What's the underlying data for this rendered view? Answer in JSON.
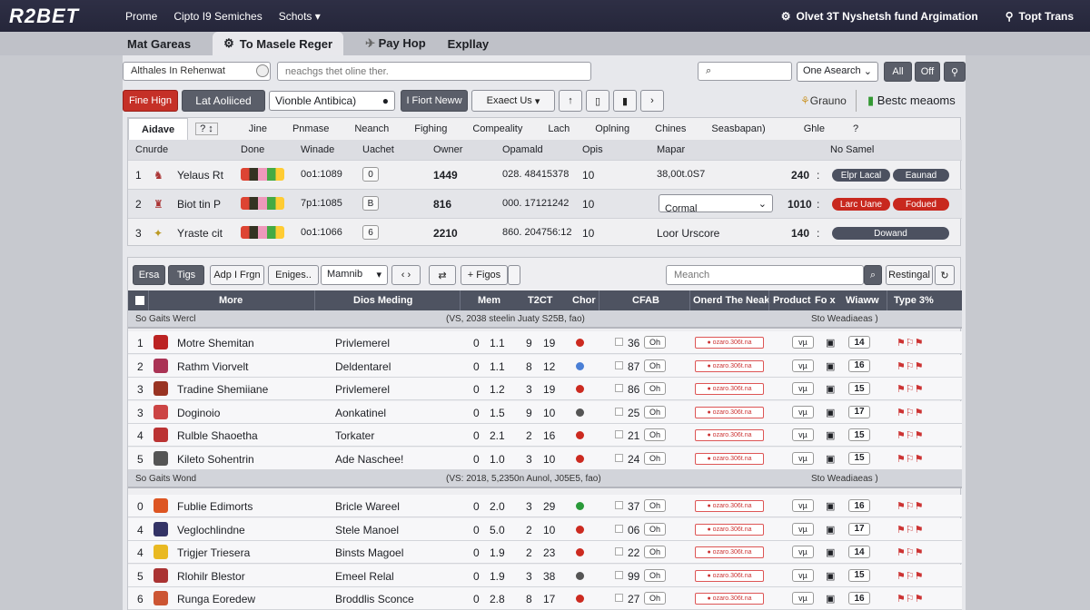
{
  "app": {
    "logo": "R2BET"
  },
  "topnav": [
    "Prome",
    "Cipto I9 Semiches",
    "Schots ▾"
  ],
  "topright": {
    "item1": "Olvet 3T Nyshetsh fund Argimation",
    "item2": "Topt Trans"
  },
  "subbar": {
    "item1": "Mat Gareas",
    "active": "To Masele Reger",
    "item3": "Pay Hop",
    "item4": "Expllay"
  },
  "filters": {
    "field1": "Althales In Rehenwat",
    "search": "",
    "search_placeholder": "neachgs thet oline ther.",
    "field3": "",
    "field3_placeholder": "",
    "select": "One Asearch",
    "btn_all": "All",
    "btn_off": "Off"
  },
  "actions": {
    "b1": "Fine Hign",
    "b2": "Lat Aoliiced",
    "b3": "Vionble Antibica)",
    "b4": "I Fiort Neww",
    "b5": "Exaect Us",
    "right1": "Grauno",
    "right2": "Bestc meaoms"
  },
  "tabs": [
    "Aidave",
    "Jine",
    "Pnmase",
    "Neanch",
    "Fighing",
    "Compeality",
    "Lach",
    "Oplning",
    "Chines",
    "Seasbapan)",
    "Ghle"
  ],
  "top_headers": {
    "h1": "Cnurde",
    "h2": "Done",
    "h3": "Winade",
    "h4": "Uachet",
    "h5": "Owner",
    "h6": "Opamald",
    "h7": "Opis",
    "h8": "Mapar",
    "h9": "No Samel"
  },
  "top_rows": [
    {
      "n": "1",
      "name": "Yelaus Rt",
      "odds": "0o1:1089",
      "owner": "1449",
      "op": "028. 48415378",
      "opis": "10",
      "mapar": "38,00t.0S7",
      "val": "240",
      "p1": "Elpr Lacal",
      "p2": "Eaunad",
      "badge": "0"
    },
    {
      "n": "2",
      "name": "Biot tin P",
      "odds": "7p1:1085",
      "owner": "816",
      "op": "000. 17121242",
      "opis": "10",
      "mapar": "Cormal",
      "val": "1010",
      "p1": "Larc Uane",
      "p2": "Fodued",
      "badge": "B"
    },
    {
      "n": "3",
      "name": "Yraste cit",
      "odds": "0o1:1066",
      "owner": "2210",
      "op": "860. 204756:12",
      "opis": "10",
      "mapar": "Loor Urscore",
      "val": "140",
      "p1": "",
      "p2": "Dowand",
      "badge": "6"
    }
  ],
  "tool2": {
    "b1": "Ersa",
    "b2": "Tigs",
    "b3": "Adp I Frgn",
    "b4": "Eniges..",
    "b5": "Mamnib",
    "b6": "+ Figos",
    "search_placeholder": "Meanch",
    "b7": "Restingal"
  },
  "main_headers": {
    "h1": "More",
    "h2": "Dios Meding",
    "h3": "Mem",
    "h4": "T2CT",
    "h5": "Chor",
    "h6": "CFAB",
    "h7": "Onerd The Neak",
    "h8": "Product",
    "h9": "Fo x",
    "h10": "Wiaww",
    "h11": "Type 3%"
  },
  "groups": [
    {
      "label": "So Gaits Wercl",
      "mid": "(VS, 2038 steelin Juaty S25B, fao)",
      "right": "Sto Weadiaeas )"
    },
    {
      "label": "So Gaits Wond",
      "mid": "(VS: 2018, 5,2350n Aunol, J05E5, fao)",
      "right": "Sto Weadiaeas )"
    }
  ],
  "main_rows": [
    {
      "n": "1",
      "name": "Motre Shemitan",
      "sub": "Privlemerel",
      "a": "0",
      "b": "1.1",
      "c": "9",
      "d": "19",
      "e": "36",
      "f": "14",
      "dot": "#cc2a20"
    },
    {
      "n": "2",
      "name": "Rathm Viorvelt",
      "sub": "Deldentarel",
      "a": "0",
      "b": "1.1",
      "c": "8",
      "d": "12",
      "e": "87",
      "f": "16",
      "dot": "#4a7fd6"
    },
    {
      "n": "3",
      "name": "Tradine Shemiiane",
      "sub": "Privlemerel",
      "a": "0",
      "b": "1.2",
      "c": "3",
      "d": "19",
      "e": "86",
      "f": "15",
      "dot": "#cc2a20"
    },
    {
      "n": "3",
      "name": "Doginoio",
      "sub": "Aonkatinel",
      "a": "0",
      "b": "1.5",
      "c": "9",
      "d": "10",
      "e": "25",
      "f": "17",
      "dot": "#555"
    },
    {
      "n": "4",
      "name": "Rulble Shaoetha",
      "sub": "Torkater",
      "a": "0",
      "b": "2.1",
      "c": "2",
      "d": "16",
      "e": "21",
      "f": "15",
      "dot": "#cc2a20"
    },
    {
      "n": "5",
      "name": "Kileto Sohentrin",
      "sub": "Ade Naschee!",
      "a": "0",
      "b": "1.0",
      "c": "3",
      "d": "10",
      "e": "24",
      "f": "15",
      "dot": "#cc2a20"
    },
    {
      "n": "0",
      "name": "Fublie Edimorts",
      "sub": "Bricle Wareel",
      "a": "0",
      "b": "2.0",
      "c": "3",
      "d": "29",
      "e": "37",
      "f": "16",
      "dot": "#2a9a3a"
    },
    {
      "n": "4",
      "name": "Veglochlindne",
      "sub": "Stele Manoel",
      "a": "0",
      "b": "5.0",
      "c": "2",
      "d": "10",
      "e": "06",
      "f": "17",
      "dot": "#cc2a20"
    },
    {
      "n": "4",
      "name": "Trigjer Triesera",
      "sub": "Binsts Magoel",
      "a": "0",
      "b": "1.9",
      "c": "2",
      "d": "23",
      "e": "22",
      "f": "14",
      "dot": "#cc2a20"
    },
    {
      "n": "5",
      "name": "Rlohilr Blestor",
      "sub": "Emeel Relal",
      "a": "0",
      "b": "1.9",
      "c": "3",
      "d": "38",
      "e": "99",
      "f": "15",
      "dot": "#555"
    },
    {
      "n": "6",
      "name": "Runga Eoredew",
      "sub": "Broddlis Sconce",
      "a": "0",
      "b": "2.8",
      "c": "8",
      "d": "17",
      "e": "27",
      "f": "16",
      "dot": "#cc2a20"
    }
  ],
  "misc": {
    "oh": "Oh",
    "tag": "● ozaro.306t.na",
    "tick": "ᴠµ"
  }
}
